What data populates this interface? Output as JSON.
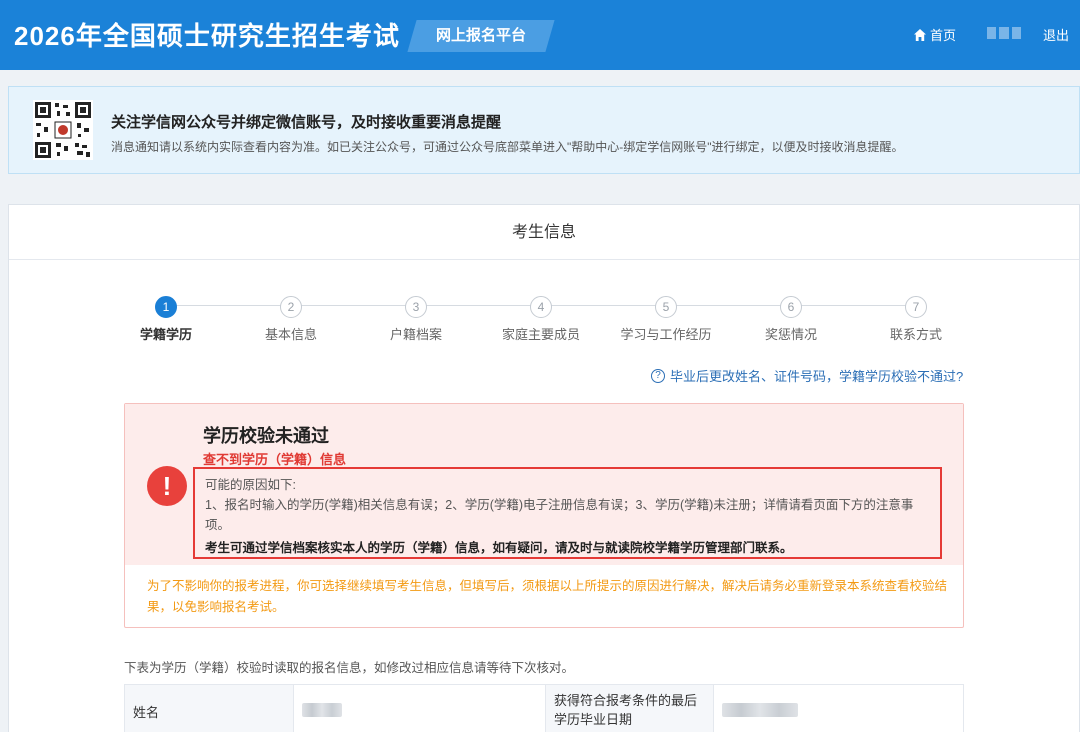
{
  "header": {
    "site_title": "2026年全国硕士研究生招生考试",
    "platform_tag": "网上报名平台",
    "nav_home": "首页",
    "nav_logout": "退出",
    "bg_color": "#1b82d8"
  },
  "notice": {
    "title": "关注学信网公众号并绑定微信账号，及时接收重要消息提醒",
    "desc": "消息通知请以系统内实际查看内容为准。如已关注公众号，可通过公众号底部菜单进入\"帮助中心-绑定学信网账号\"进行绑定，以便及时接收消息提醒。"
  },
  "card": {
    "title": "考生信息"
  },
  "steps": [
    {
      "num": "1",
      "label": "学籍学历",
      "active": true
    },
    {
      "num": "2",
      "label": "基本信息",
      "active": false
    },
    {
      "num": "3",
      "label": "户籍档案",
      "active": false
    },
    {
      "num": "4",
      "label": "家庭主要成员",
      "active": false
    },
    {
      "num": "5",
      "label": "学习与工作经历",
      "active": false
    },
    {
      "num": "6",
      "label": "奖惩情况",
      "active": false
    },
    {
      "num": "7",
      "label": "联系方式",
      "active": false
    }
  ],
  "help_link": "毕业后更改姓名、证件号码，学籍学历校验不通过?",
  "alert": {
    "icon": "!",
    "title": "学历校验未通过",
    "subtitle": "查不到学历（学籍）信息",
    "reason_heading": "可能的原因如下:",
    "reason_line1": "1、报名时输入的学历(学籍)相关信息有误；2、学历(学籍)电子注册信息有误；3、学历(学籍)未注册；详情请看页面下方的注意事",
    "reason_line2": "项。",
    "reason_tip": "考生可通过学信档案核实本人的学历（学籍）信息，如有疑问，请及时与就读院校学籍学历管理部门联系。",
    "warning": "为了不影响你的报考进程，你可选择继续填写考生信息，但填写后，须根据以上所提示的原因进行解决，解决后请务必重新登录本系统查看校验结果，以免影响报名考试。",
    "error_color": "#e8413c",
    "warning_color": "#f39a14"
  },
  "table_note": "下表为学历（学籍）校验时读取的报名信息，如修改过相应信息请等待下次核对。",
  "table": {
    "row1": {
      "label1": "姓名",
      "label2_line1": "获得符合报考条件的最后",
      "label2_line2": "学历毕业日期"
    }
  }
}
